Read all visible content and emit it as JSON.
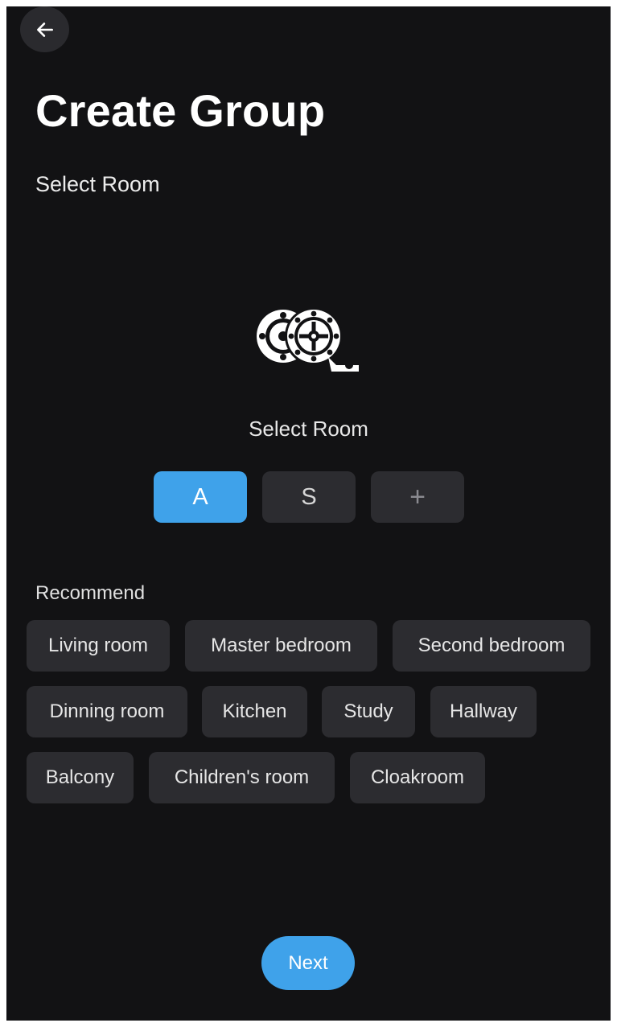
{
  "header": {
    "back_icon": "arrow-left-icon",
    "title": "Create Group",
    "subtitle": "Select Room"
  },
  "room_selector": {
    "icon": "film-reel-icon",
    "label": "Select Room",
    "tabs": [
      {
        "label": "A",
        "active": true
      },
      {
        "label": "S",
        "active": false
      },
      {
        "label": "+",
        "active": false
      }
    ]
  },
  "recommend": {
    "label": "Recommend",
    "chips": [
      "Living room",
      "Master bedroom",
      "Second bedroom",
      "Dinning room",
      "Kitchen",
      "Study",
      "Hallway",
      "Balcony",
      "Children's room",
      "Cloakroom"
    ]
  },
  "footer": {
    "next_label": "Next"
  },
  "colors": {
    "background": "#121214",
    "surface": "#2c2c30",
    "accent": "#3fa2ea",
    "text": "#ffffff"
  }
}
